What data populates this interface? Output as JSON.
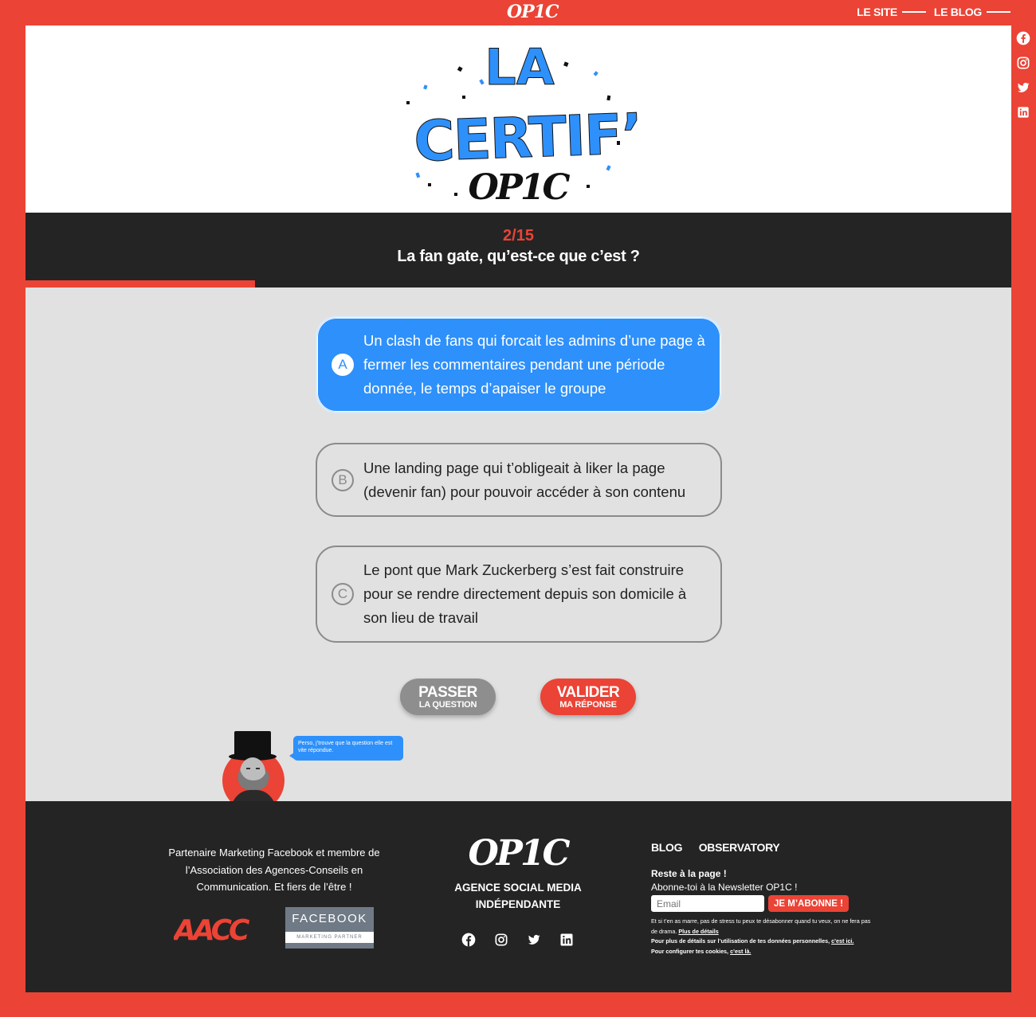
{
  "brand": {
    "logo": "OP1C",
    "accent": "#eb4335",
    "blue": "#2e90fa",
    "dark": "#242424"
  },
  "topnav": {
    "site": "LE SITE",
    "blog": "LE BLOG"
  },
  "social_icons": [
    "facebook-icon",
    "instagram-icon",
    "twitter-icon",
    "linkedin-icon"
  ],
  "hero": {
    "line1": "LA",
    "line2": "CERTIF’",
    "line3": "OP1C"
  },
  "question": {
    "number": "2/15",
    "text": "La fan gate, qu’est-ce que c’est ?",
    "progress": 0.233
  },
  "answers": [
    {
      "letter": "A",
      "text": "Un clash de fans qui forcait les admins d’une page à fermer les commentaires pendant une période donnée, le temps d’apaiser le groupe",
      "selected": true
    },
    {
      "letter": "B",
      "text": "Une landing page qui t’obligeait à liker la page (devenir fan) pour pouvoir accéder à son contenu",
      "selected": false
    },
    {
      "letter": "C",
      "text": "Le pont que Mark Zuckerberg s’est fait construire pour se rendre directement depuis son domicile à son lieu de travail",
      "selected": false
    }
  ],
  "buttons": {
    "skip_line1": "PASSER",
    "skip_line2": "LA QUESTION",
    "validate_line1": "VALIDER",
    "validate_line2": "MA RÉPONSE"
  },
  "bubble": "Perso, j’trouve que la question elle est vite répondue.",
  "footer": {
    "partner_text": "Partenaire Marketing Facebook et membre de l’Association des Agences-Conseils en Communication. Et fiers de l’être !",
    "aacc": "AACC",
    "fb_badge": "FACEBOOK",
    "fb_badge_sub": "MARKETING PARTNER",
    "logo": "OP1C",
    "tagline_1": "AGENCE SOCIAL MEDIA",
    "tagline_2": "INDÉPENDANTE",
    "link_blog": "BLOG",
    "link_observatory": "OBSERVATORY",
    "nl_title": "Reste à la page !",
    "nl_sub": "Abonne-toi à la Newsletter OP1C !",
    "email_placeholder": "Email",
    "subscribe": "JE M’ABONNE !",
    "small1": "Et si t’en as marre, pas de stress tu peux te désabonner quand tu veux, on ne fera pas de drama.",
    "small1_link": "Plus de détails",
    "small2": "Pour plus de détails sur l’utilisation de tes données personnelles,",
    "small2_link": "c’est ici.",
    "small3": "Pour configurer tes cookies,",
    "small3_link": "c’est là."
  }
}
